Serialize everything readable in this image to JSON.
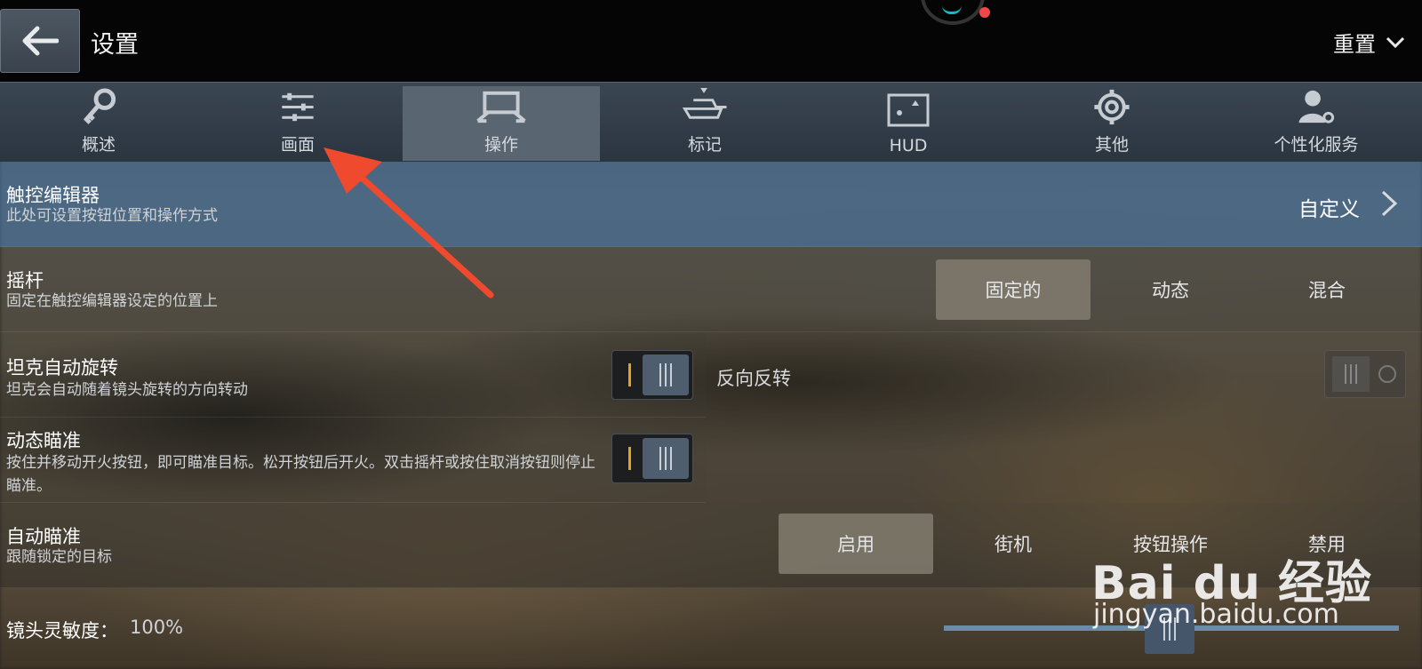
{
  "header": {
    "title": "设置",
    "reset_label": "重置"
  },
  "tabs": [
    {
      "label": "概述",
      "icon": "key-icon"
    },
    {
      "label": "画面",
      "icon": "sliders-icon"
    },
    {
      "label": "操作",
      "icon": "controls-icon",
      "active": true
    },
    {
      "label": "标记",
      "icon": "tank-marker-icon"
    },
    {
      "label": "HUD",
      "icon": "hud-icon"
    },
    {
      "label": "其他",
      "icon": "gear-icon"
    },
    {
      "label": "个性化服务",
      "icon": "user-settings-icon"
    }
  ],
  "rows": {
    "touch_editor": {
      "title": "触控编辑器",
      "subtitle": "此处可设置按钮位置和操作方式",
      "value": "自定义"
    },
    "joystick": {
      "title": "摇杆",
      "subtitle": "固定在触控编辑器设定的位置上",
      "options": [
        "固定的",
        "动态",
        "混合"
      ],
      "selected": "固定的"
    },
    "tank_rotate": {
      "title": "坦克自动旋转",
      "subtitle": "坦克会自动随着镜头旋转的方向转动",
      "enabled": false
    },
    "reverse": {
      "label": "反向反转"
    },
    "dynamic_aim": {
      "title": "动态瞄准",
      "subtitle": "按住并移动开火按钮，即可瞄准目标。松开按钮后开火。双击摇杆或按住取消按钮则停止瞄准。",
      "enabled": false
    },
    "auto_aim": {
      "title": "自动瞄准",
      "subtitle": "跟随锁定的目标",
      "options": [
        "启用",
        "街机",
        "按钮操作",
        "禁用"
      ],
      "selected": "启用"
    },
    "camera_sens": {
      "label": "镜头灵敏度：",
      "value": "100%"
    }
  },
  "watermark": {
    "main": "Bai du 经验",
    "sub": "jingyan.baidu.com"
  },
  "colors": {
    "accent": "#3c648c",
    "arrow": "#f04a2e",
    "toggle_mark": "#e4a21f"
  }
}
